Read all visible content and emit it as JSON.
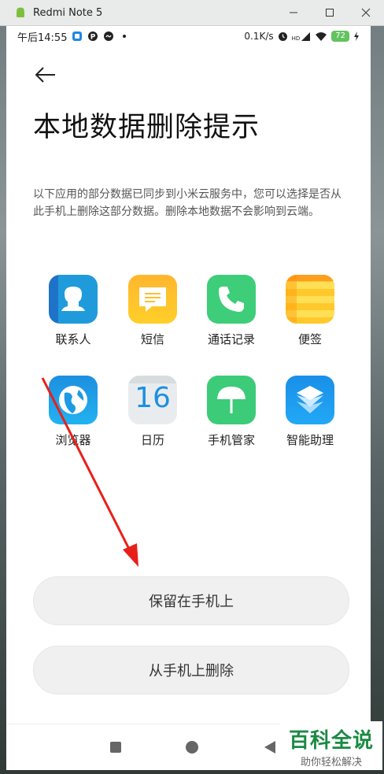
{
  "window": {
    "title": "Redmi Note 5"
  },
  "statusbar": {
    "time": "午后14:55",
    "speed": "0.1K/s",
    "hd": "HD",
    "battery": "72"
  },
  "page": {
    "title": "本地数据删除提示",
    "description": "以下应用的部分数据已同步到小米云服务中，您可以选择是否从此手机上删除这部分数据。删除本地数据不会影响到云端。"
  },
  "apps": [
    {
      "label": "联系人",
      "icon": "contacts-icon"
    },
    {
      "label": "短信",
      "icon": "messages-icon"
    },
    {
      "label": "通话记录",
      "icon": "phone-icon"
    },
    {
      "label": "便签",
      "icon": "notes-icon"
    },
    {
      "label": "浏览器",
      "icon": "browser-icon"
    },
    {
      "label": "日历",
      "icon": "calendar-icon",
      "day": "16"
    },
    {
      "label": "手机管家",
      "icon": "security-icon"
    },
    {
      "label": "智能助理",
      "icon": "assistant-icon"
    }
  ],
  "buttons": {
    "keep": "保留在手机上",
    "delete": "从手机上删除"
  },
  "watermark": {
    "main": "百科全说",
    "sub": "助你轻松解决"
  },
  "colors": {
    "accent_green": "#1a8a43",
    "arrow_red": "#e8201a"
  }
}
